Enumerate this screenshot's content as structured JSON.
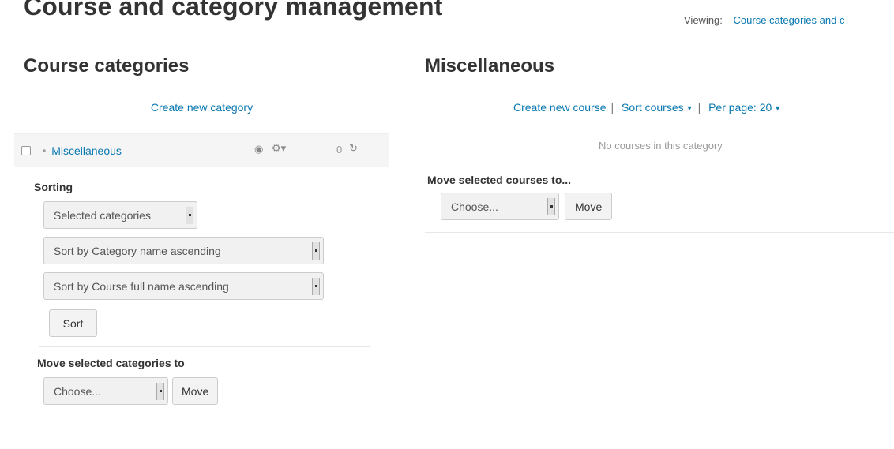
{
  "header": {
    "title": "Course and category management",
    "viewing_label": "Viewing:",
    "viewing_value": "Course categories and c"
  },
  "left": {
    "title": "Course categories",
    "create_link": "Create new category",
    "category": {
      "name": "Miscellaneous",
      "count": "0"
    },
    "sorting_label": "Sorting",
    "sort_selects": [
      "Selected categories",
      "Sort by Category name ascending",
      "Sort by Course full name ascending"
    ],
    "sort_button": "Sort",
    "move_label": "Move selected categories to",
    "move_select": "Choose...",
    "move_button": "Move"
  },
  "right": {
    "title": "Miscellaneous",
    "create_link": "Create new course",
    "sort_link": "Sort courses",
    "per_page": "Per page: 20",
    "empty_text": "No courses in this category",
    "move_label": "Move selected courses to...",
    "move_select": "Choose...",
    "move_button": "Move"
  },
  "colors": {
    "link": "#0a78b0",
    "text": "#333333",
    "row_bg": "#f5f5f5"
  },
  "icons": {
    "eye": "eye-icon",
    "gear": "gear-icon",
    "refresh": "refresh-icon"
  }
}
